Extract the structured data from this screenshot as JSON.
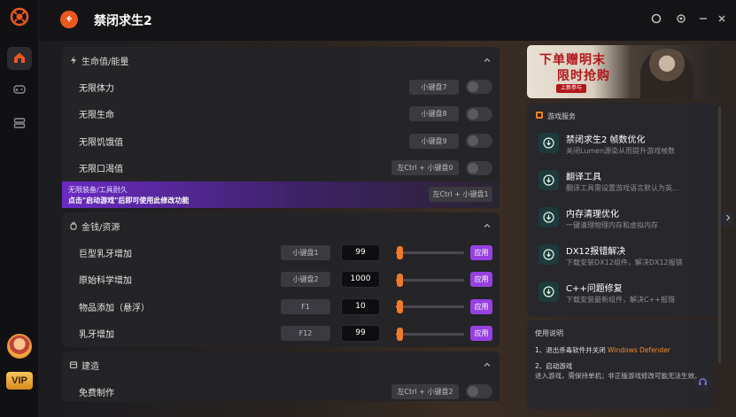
{
  "app": {
    "title": "禁闭求生2"
  },
  "window_controls": [
    "theme-icon",
    "settings-icon",
    "minimize-icon",
    "close-icon"
  ],
  "sections": {
    "health": {
      "title": "生命值/能量",
      "rows": [
        {
          "label": "无限体力",
          "hotkey": "小键盘7",
          "enabled": false
        },
        {
          "label": "无限生命",
          "hotkey": "小键盘8",
          "enabled": false
        },
        {
          "label": "无限饥饿值",
          "hotkey": "小键盘9",
          "enabled": false
        },
        {
          "label": "无限口渴值",
          "hotkey": "左Ctrl + 小键盘0",
          "enabled": false
        }
      ],
      "notice": {
        "line1": "无限装备/工具耐久",
        "line2": "点击\"启动游戏\"后即可使用此修改功能",
        "hotkey": "左Ctrl + 小键盘1"
      }
    },
    "money": {
      "title": "金钱/资源",
      "apply_label": "应用",
      "rows": [
        {
          "label": "巨型乳牙增加",
          "hotkey": "小键盘1",
          "value": "99",
          "level": 0.05
        },
        {
          "label": "原始科学增加",
          "hotkey": "小键盘2",
          "value": "1000",
          "level": 0.05
        },
        {
          "label": "物品添加（悬浮）",
          "hotkey": "F1",
          "value": "10",
          "level": 0.05
        },
        {
          "label": "乳牙增加",
          "hotkey": "F12",
          "value": "99",
          "level": 0.05
        }
      ]
    },
    "build": {
      "title": "建造",
      "rows": [
        {
          "label": "免费制作",
          "hotkey": "左Ctrl + 小键盘2",
          "enabled": false
        }
      ]
    }
  },
  "banner": {
    "line1": "下单赠明末",
    "line2": "限时抢购",
    "badge": "上新参与"
  },
  "services": {
    "title": "游戏服务",
    "items": [
      {
        "name": "禁闭求生2 帧数优化",
        "desc": "关闭Lumen源染从而提升游戏帧数"
      },
      {
        "name": "翻译工具",
        "desc": "翻译工具需设置游戏语言默认为英..."
      },
      {
        "name": "内存清理优化",
        "desc": "一键清理物理内存和虚拟内存"
      },
      {
        "name": "DX12报错解决",
        "desc": "下载安装DX12组件，解决DX12报错"
      },
      {
        "name": "C++问题修复",
        "desc": "下载安装最新组件，解决C++报错"
      }
    ]
  },
  "guide": {
    "title": "使用说明",
    "step1_prefix": "1、退出杀毒软件并关闭",
    "step1_highlight": "Windows Defender",
    "step2_title": "2、启动游戏",
    "step2_text": "进入游戏，需保持单机；非正版游戏修改可能无法生效。"
  },
  "colors": {
    "accent": "#e8581f",
    "apply": "#9640e0",
    "slider": "#f07a2a"
  },
  "vip_label": "VIP"
}
